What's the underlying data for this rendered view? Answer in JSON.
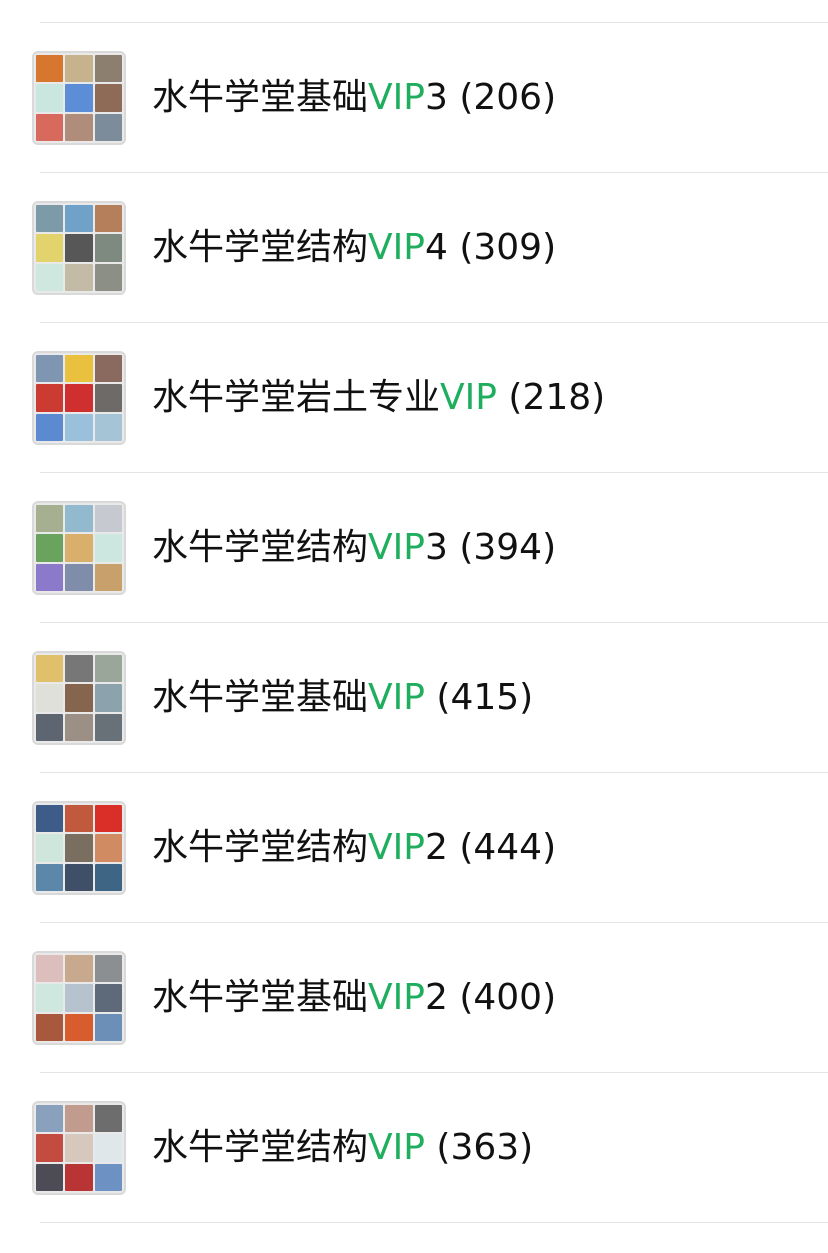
{
  "groups": [
    {
      "prefix": "水牛学堂基础",
      "vip": "VIP",
      "suffix": "3 (206)",
      "tiles": [
        "#d7772f",
        "#c7b28e",
        "#8d7f6f",
        "#c9e6df",
        "#5b8ed6",
        "#8e6b56",
        "#d76a5d",
        "#b08d7b",
        "#7d8c9a"
      ]
    },
    {
      "prefix": "水牛学堂结构",
      "vip": "VIP",
      "suffix": "4 (309)",
      "tiles": [
        "#7d9aa9",
        "#6fa1c9",
        "#b67f5c",
        "#e3d36d",
        "#575757",
        "#7e8a7f",
        "#cfe8df",
        "#c4bba7",
        "#8c8f86"
      ]
    },
    {
      "prefix": "水牛学堂岩土专业",
      "vip": "VIP",
      "suffix": " (218)",
      "tiles": [
        "#7e96b1",
        "#e9c13f",
        "#8a6a5e",
        "#cc3b32",
        "#cf2f2f",
        "#6e6a68",
        "#5c8ad0",
        "#9ac0dc",
        "#a5c4d6"
      ]
    },
    {
      "prefix": "水牛学堂结构",
      "vip": "VIP",
      "suffix": "3 (394)",
      "tiles": [
        "#a6b091",
        "#93b9cf",
        "#c7c9d1",
        "#6aa35d",
        "#d8b06b",
        "#cbe7df",
        "#8b79c9",
        "#7f8daa",
        "#c7a06b"
      ]
    },
    {
      "prefix": "水牛学堂基础",
      "vip": "VIP",
      "suffix": " (415)",
      "tiles": [
        "#e0c06b",
        "#777777",
        "#9aa69a",
        "#dfe1d8",
        "#85654d",
        "#8ca3ad",
        "#5c6570",
        "#9c8f85",
        "#687078"
      ]
    },
    {
      "prefix": "水牛学堂结构",
      "vip": "VIP",
      "suffix": "2 (444)",
      "tiles": [
        "#3d5c88",
        "#c15a3d",
        "#d92f28",
        "#cfe6dd",
        "#7a6e61",
        "#d08b62",
        "#5d87a8",
        "#3f4f68",
        "#3f6585"
      ]
    },
    {
      "prefix": "水牛学堂基础",
      "vip": "VIP",
      "suffix": "2 (400)",
      "tiles": [
        "#dcbfbd",
        "#c9a98e",
        "#8b8f91",
        "#cfe8df",
        "#b6c3cf",
        "#5e6a7a",
        "#a8583c",
        "#d85d2e",
        "#6b8fb6"
      ]
    },
    {
      "prefix": "水牛学堂结构",
      "vip": "VIP",
      "suffix": " (363)",
      "tiles": [
        "#8aa1bd",
        "#c29b8f",
        "#6d6d6d",
        "#c34b3f",
        "#d6c8bd",
        "#dfe7ea",
        "#4d4c56",
        "#b93535",
        "#6c91c2"
      ]
    }
  ]
}
